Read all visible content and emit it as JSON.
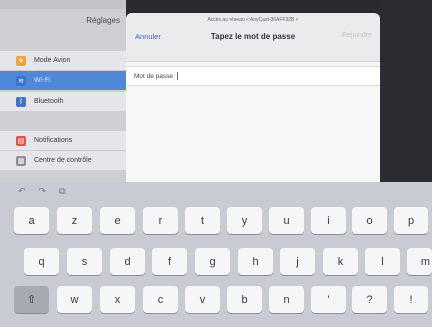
{
  "sidebar": {
    "title": "Réglages",
    "items": [
      {
        "label": "Mode Avion",
        "icon": "airplane-icon",
        "color": "#f0a53a"
      },
      {
        "label": "Wi-Fi",
        "icon": "wifi-icon",
        "color": "#4f88d9",
        "active": true
      },
      {
        "label": "Bluetooth",
        "icon": "bluetooth-icon",
        "color": "#3f73d0"
      },
      {
        "label": "Notifications",
        "icon": "notifications-icon",
        "color": "#e5534b"
      },
      {
        "label": "Centre de contrôle",
        "icon": "control-center-icon",
        "color": "#8e8e93"
      }
    ]
  },
  "modal": {
    "subtitle": "Accès au réseau « AnyCast-36AFF32B »",
    "cancel": "Annuler",
    "title": "Tapez le mot de passe",
    "join": "Rejoindre",
    "password_label": "Mot de passe"
  },
  "keyboard": {
    "shortcuts": [
      "↶",
      "↷",
      "⧉"
    ],
    "row1": [
      "a",
      "z",
      "e",
      "r",
      "t",
      "y",
      "u",
      "i",
      "o",
      "p"
    ],
    "row2": [
      "q",
      "s",
      "d",
      "f",
      "g",
      "h",
      "j",
      "k",
      "l",
      "m"
    ],
    "row3": [
      "w",
      "x",
      "c",
      "v",
      "b",
      "n",
      "’",
      "?"
    ],
    "shift": "⇧",
    "extra": "!"
  }
}
